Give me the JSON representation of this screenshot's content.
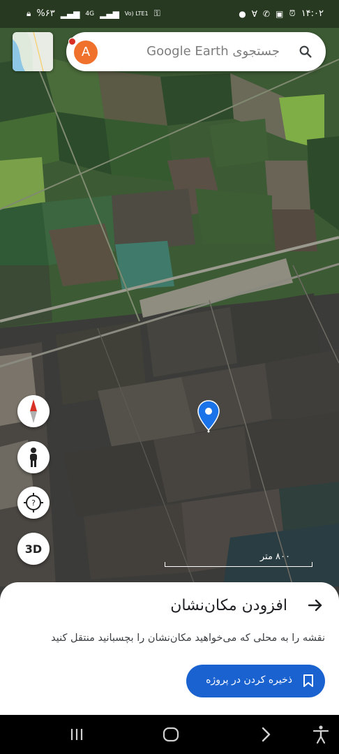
{
  "status_bar": {
    "time": "۱۴:۰۲",
    "battery": "%۶۳",
    "network": "4G",
    "volte": "Vo) LTE1"
  },
  "search": {
    "avatar_letter": "A",
    "placeholder": "جستجوی Google Earth"
  },
  "map_controls": {
    "three_d_label": "3D"
  },
  "scale": {
    "label": "۸۰۰ متر"
  },
  "sheet": {
    "title": "افزودن مکان‌نشان",
    "description": "نقشه را به محلی که می‌خواهید مکان‌نشان را بچسبانید منتقل کنید",
    "save_button_label": "ذخیره کردن در پروژه"
  },
  "colors": {
    "accent": "#1a62d0",
    "avatar": "#f0712c",
    "pin": "#1a73e8",
    "notification_dot": "#d93025"
  }
}
